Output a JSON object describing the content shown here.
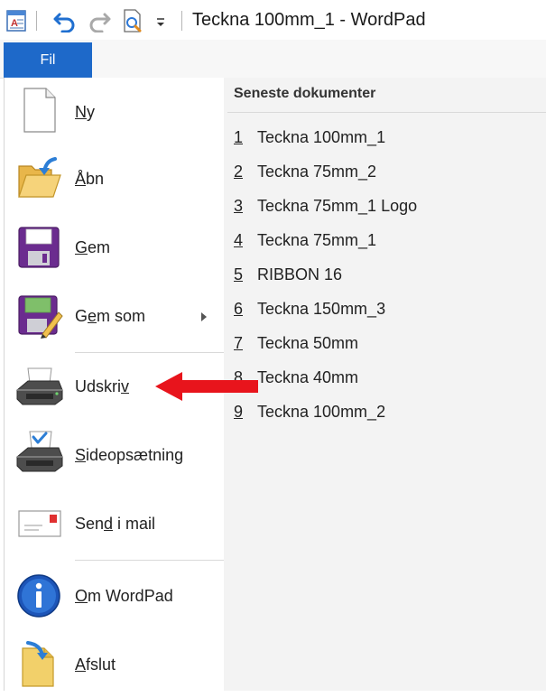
{
  "window": {
    "title": "Teckna 100mm_1 - WordPad"
  },
  "qat": {
    "icons": [
      "wordpad-app-icon",
      "undo-icon",
      "redo-icon",
      "print-preview-icon",
      "customize-qat-icon"
    ]
  },
  "ribbon": {
    "file_tab": "Fil"
  },
  "file_menu": {
    "items": [
      {
        "id": "ny",
        "pre": "",
        "key": "N",
        "post": "y",
        "icon": "new-document-icon"
      },
      {
        "id": "abn",
        "pre": "",
        "key": "Å",
        "post": "bn",
        "icon": "open-folder-icon"
      },
      {
        "id": "gem",
        "pre": "",
        "key": "G",
        "post": "em",
        "icon": "save-icon"
      },
      {
        "id": "gem-som",
        "pre": "G",
        "key": "e",
        "post": "m som",
        "icon": "save-as-icon",
        "has_submenu": true
      },
      {
        "id": "udskriv",
        "pre": "Udskri",
        "key": "v",
        "post": "",
        "icon": "printer-icon"
      },
      {
        "id": "sideopsaetning",
        "pre": "",
        "key": "S",
        "post": "ideopsætning",
        "icon": "page-setup-icon"
      },
      {
        "id": "send-i-mail",
        "pre": "Sen",
        "key": "d",
        "post": " i mail",
        "icon": "email-icon"
      },
      {
        "id": "om-wordpad",
        "pre": "",
        "key": "O",
        "post": "m WordPad",
        "icon": "info-icon"
      },
      {
        "id": "afslut",
        "pre": "",
        "key": "A",
        "post": "fslut",
        "icon": "exit-icon"
      }
    ]
  },
  "recent": {
    "header": "Seneste dokumenter",
    "items": [
      {
        "num": "1",
        "name": "Teckna 100mm_1"
      },
      {
        "num": "2",
        "name": "Teckna 75mm_2"
      },
      {
        "num": "3",
        "name": "Teckna 75mm_1 Logo"
      },
      {
        "num": "4",
        "name": "Teckna 75mm_1"
      },
      {
        "num": "5",
        "name": "RIBBON 16"
      },
      {
        "num": "6",
        "name": "Teckna 150mm_3"
      },
      {
        "num": "7",
        "name": "Teckna 50mm"
      },
      {
        "num": "8",
        "name": "Teckna 40mm"
      },
      {
        "num": "9",
        "name": "Teckna 100mm_2"
      }
    ]
  },
  "annotation": {
    "icon": "red-arrow-icon",
    "color": "#e8141c"
  },
  "colors": {
    "file_tab": "#1e69c9",
    "recent_bg": "#f3f3f3"
  }
}
